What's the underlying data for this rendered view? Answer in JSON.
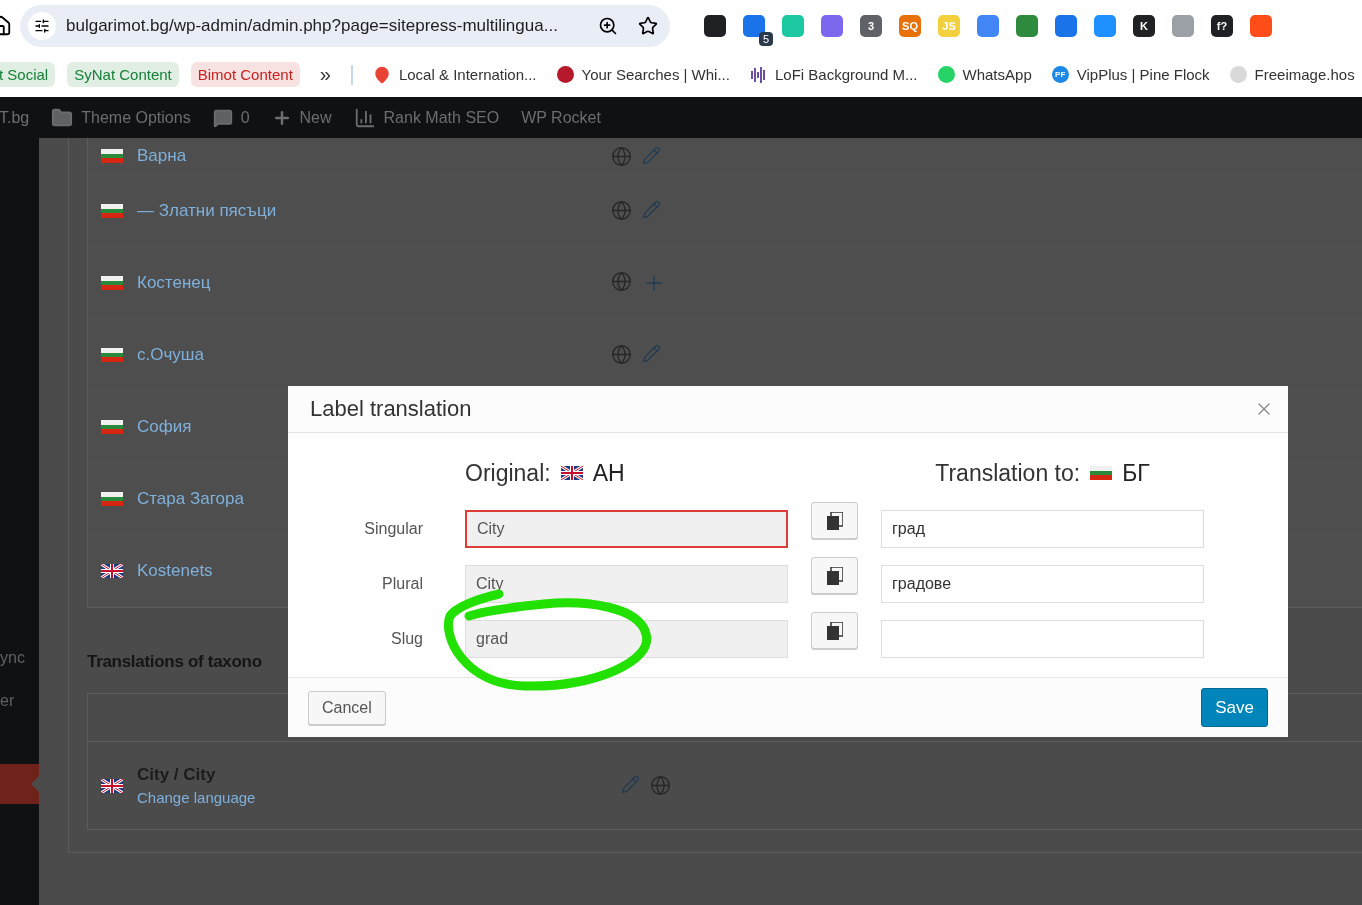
{
  "browser": {
    "address": "bulgarimot.bg/wp-admin/admin.php?page=sitepress-multilingua...",
    "extensions": [
      {
        "color": "#202124"
      },
      {
        "color": "#1a73e8",
        "badge": "5"
      },
      {
        "color": "#1cc8a0"
      },
      {
        "color": "#7b68ee"
      },
      {
        "color": "#5f6368",
        "label": "3"
      },
      {
        "color": "#e8710a",
        "label": "SQ"
      },
      {
        "color": "#f4d03f",
        "label": "JS"
      },
      {
        "color": "#4285f4"
      },
      {
        "color": "#2e8b3e"
      },
      {
        "color": "#1a73e8"
      },
      {
        "color": "#1e90ff"
      },
      {
        "color": "#202124",
        "label": "K"
      },
      {
        "color": "#9aa0a6"
      },
      {
        "color": "#202124",
        "label": "f?"
      },
      {
        "color": "#ff4d1a"
      }
    ]
  },
  "bookmarks": {
    "chips": [
      {
        "label": "t Social",
        "color": "#188038"
      },
      {
        "label": "SyNat Content",
        "color": "#188038"
      },
      {
        "label": "Bimot Content",
        "color": "#c5221f"
      }
    ],
    "more": "»",
    "links": [
      {
        "label": "Local & Internation..."
      },
      {
        "label": "Your Searches | Whi..."
      },
      {
        "label": "LoFi Background M..."
      },
      {
        "label": "WhatsApp"
      },
      {
        "icon_text": "PF",
        "label": "VipPlus | Pine Flock"
      },
      {
        "label": "Freeimage.hos"
      }
    ]
  },
  "admin_bar": [
    {
      "label": "T.bg"
    },
    {
      "label": "Theme Options"
    },
    {
      "label": "0"
    },
    {
      "label": "New"
    },
    {
      "label": "Rank Math SEO"
    },
    {
      "label": "WP Rocket"
    }
  ],
  "sidebar": {
    "items": [
      {
        "label": "ync",
        "selected": false
      },
      {
        "label": "er",
        "selected": false
      },
      {
        "selected": true
      }
    ]
  },
  "terms": [
    {
      "kind": "bulgarian",
      "name": "Варна"
    },
    {
      "kind": "bulgarian",
      "name": "— Златни пясъци"
    },
    {
      "kind": "bulgarian",
      "name": "Костенец"
    },
    {
      "kind": "bulgarian",
      "name": "с.Очуша"
    },
    {
      "kind": "bulgarian",
      "name": "София"
    },
    {
      "kind": "bulgarian",
      "name": "Стара Загора"
    },
    {
      "kind": "english",
      "name": "Kostenets"
    }
  ],
  "taxonomy": {
    "heading": "Translations of taxono",
    "rows": [
      {
        "kind": "english",
        "name": "City / City",
        "link": "Change language"
      }
    ]
  },
  "dialog": {
    "title": "Label translation",
    "original_heading": "Original:",
    "original_lang": {
      "kind": "english",
      "code": "АН"
    },
    "translation_heading": "Translation to:",
    "translation_lang": {
      "kind": "bulgarian",
      "code": "БГ"
    },
    "rows": [
      {
        "label": "Singular",
        "original": "City",
        "translation": "град",
        "error": true
      },
      {
        "label": "Plural",
        "original": "City",
        "translation": "градове",
        "error": false
      },
      {
        "label": "Slug",
        "original": "grad",
        "error": false
      }
    ],
    "cancel": "Cancel",
    "save": "Save"
  }
}
